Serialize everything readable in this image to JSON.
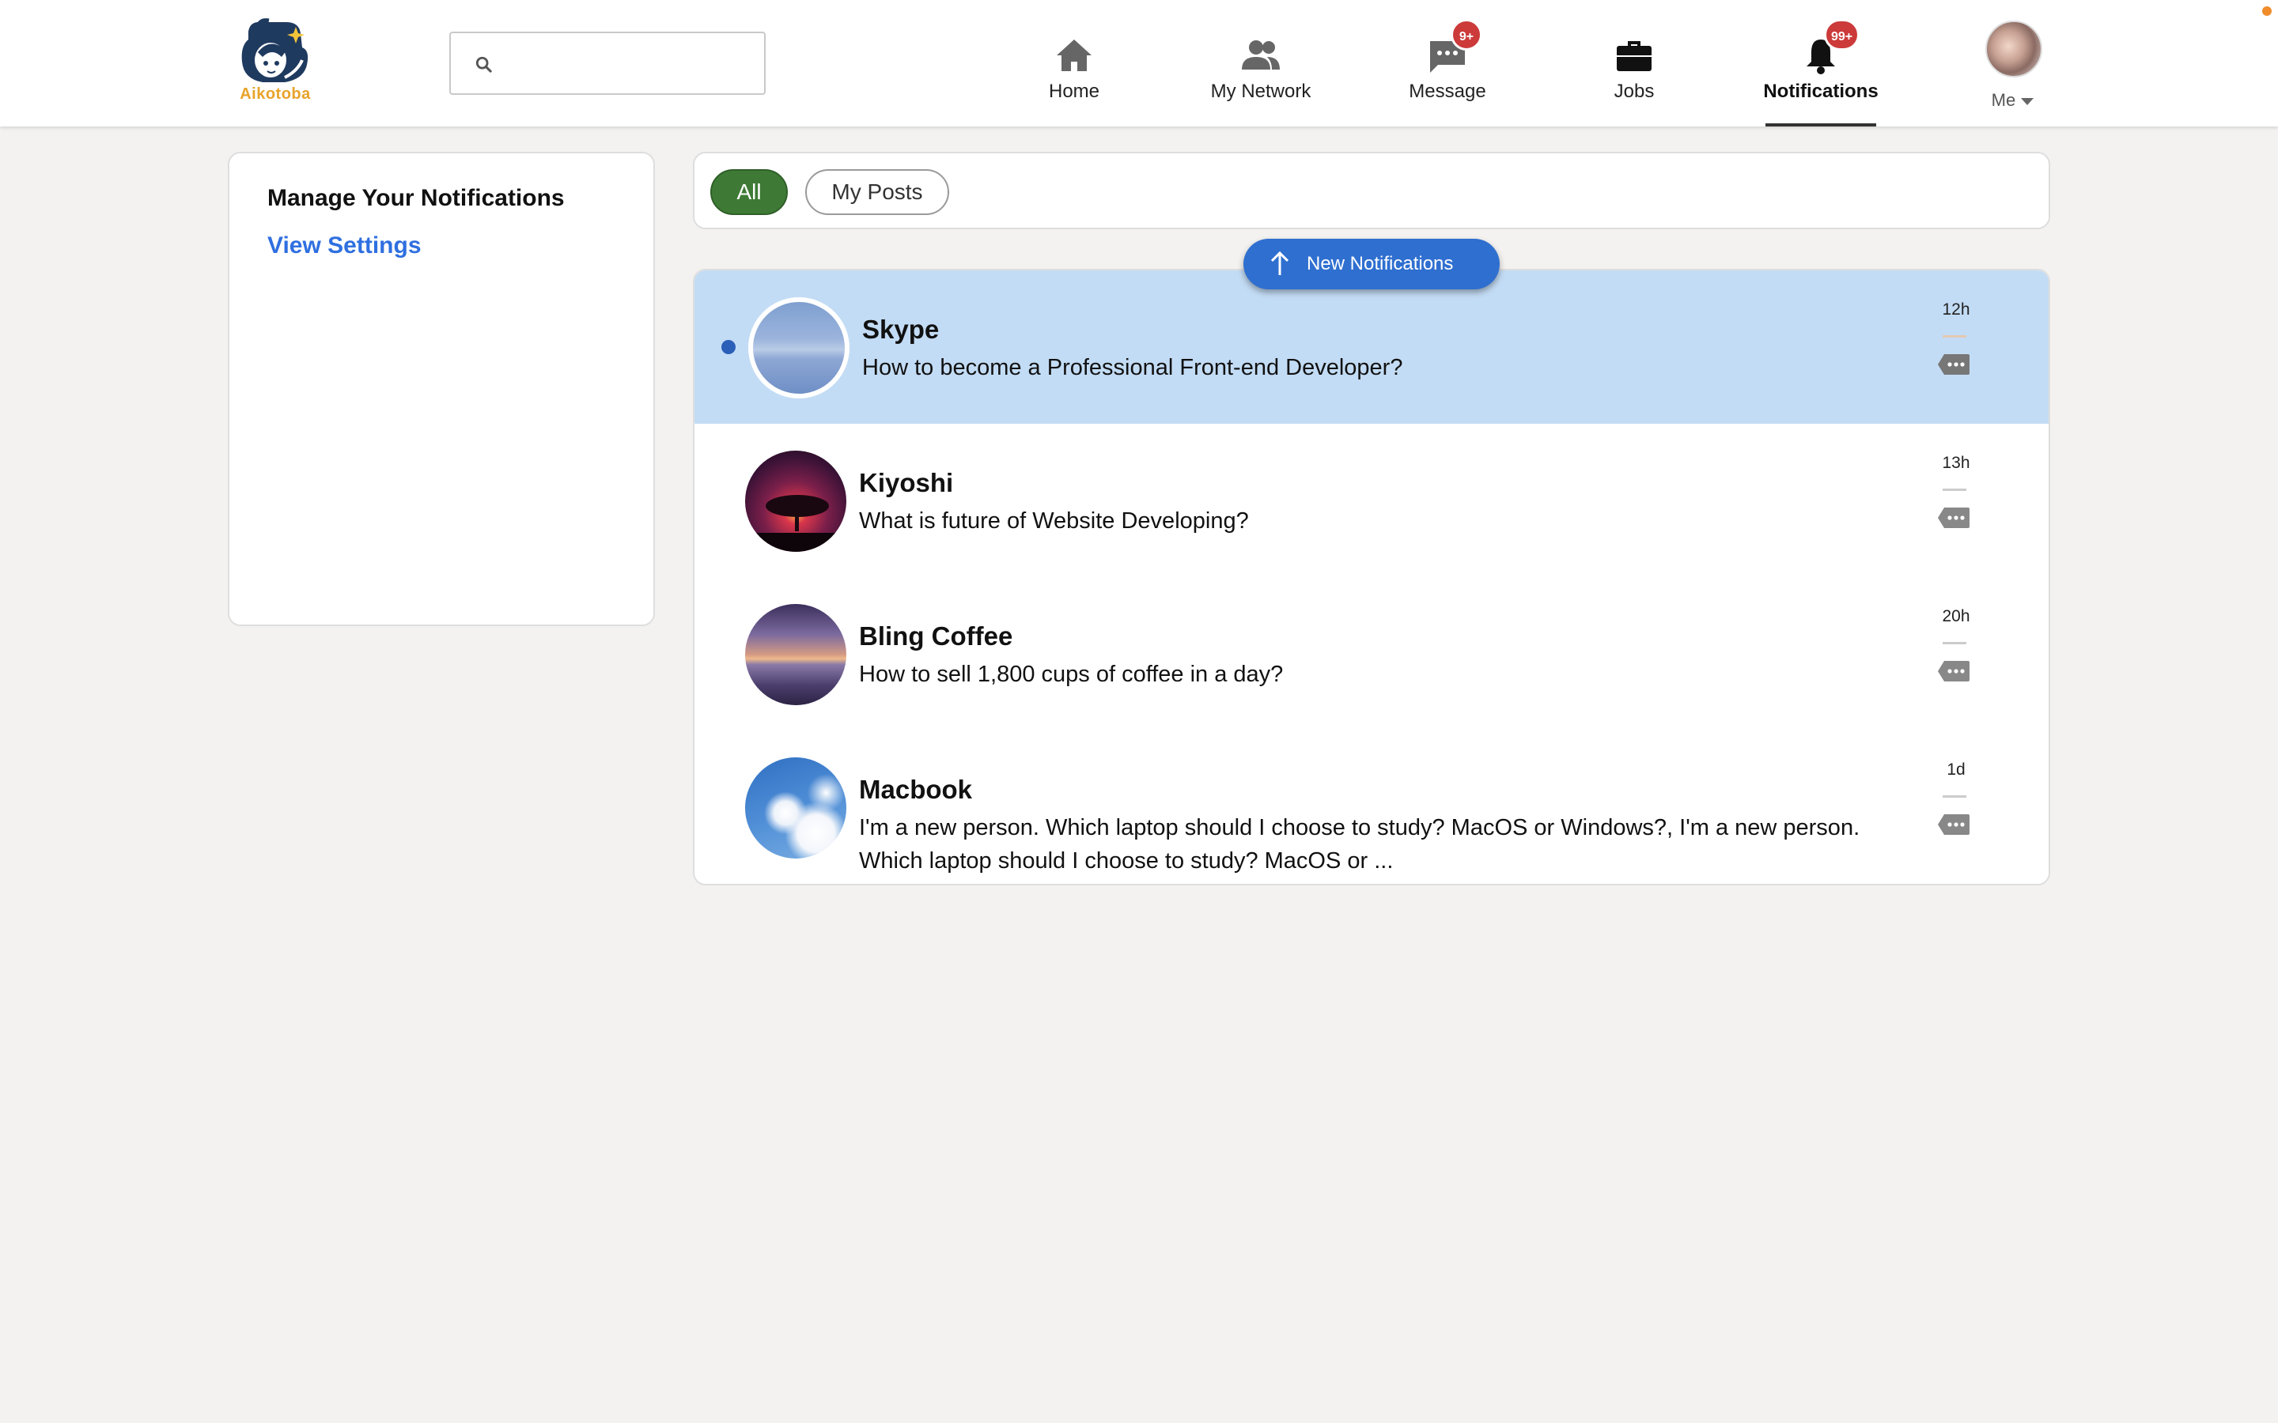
{
  "brand": {
    "name": "Aikotoba",
    "accent": "#e8a32a",
    "navy": "#1f3a5f"
  },
  "search": {
    "placeholder": "",
    "value": ""
  },
  "nav": {
    "items": [
      {
        "label": "Home",
        "icon": "home-icon"
      },
      {
        "label": "My Network",
        "icon": "people-icon"
      },
      {
        "label": "Message",
        "icon": "message-icon",
        "badge": "9+"
      },
      {
        "label": "Jobs",
        "icon": "briefcase-icon"
      },
      {
        "label": "Notifications",
        "icon": "bell-icon",
        "badge": "99+",
        "active": true
      }
    ],
    "me_label": "Me"
  },
  "sidebar": {
    "title": "Manage Your Notifications",
    "link": "View Settings"
  },
  "filters": {
    "all": "All",
    "my_posts": "My Posts",
    "selected": "All"
  },
  "new_notifications_label": "New Notifications",
  "notifications": [
    {
      "name": "Skype",
      "text": "How to become a Professional Front-end Developer?",
      "time": "12h",
      "unread": true
    },
    {
      "name": "Kiyoshi",
      "text": "What is future of Website Developing?",
      "time": "13h",
      "unread": false
    },
    {
      "name": "Bling Coffee",
      "text": "How to sell 1,800 cups of coffee in a day?",
      "time": "20h",
      "unread": false
    },
    {
      "name": "Macbook",
      "text": "I'm a new person. Which laptop should I choose to study? MacOS or Windows?, I'm a new person. Which laptop should I choose to study? MacOS or ...",
      "time": "1d",
      "unread": false
    }
  ],
  "colors": {
    "unread_bg": "#c3dcf5",
    "badge": "#cc3a3a",
    "filter_active": "#3e7a35",
    "link": "#2f6fe0",
    "new_pill": "#2f6fd0"
  }
}
